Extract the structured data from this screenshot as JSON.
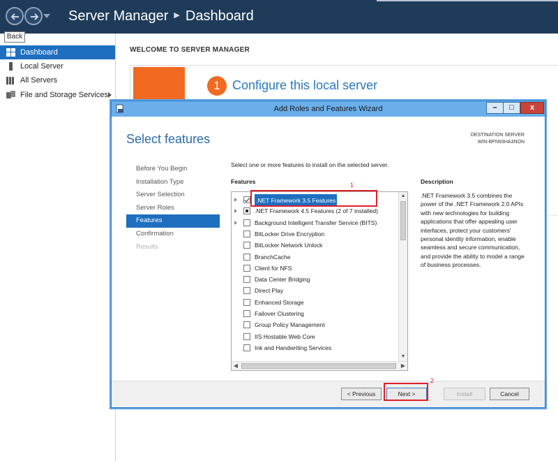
{
  "server_manager": {
    "title": "Server Manager",
    "breadcrumb_current": "Dashboard",
    "tooltip": "Back",
    "sidebar": {
      "items": [
        {
          "label": "Dashboard",
          "icon": "dashboard-icon",
          "active": true
        },
        {
          "label": "Local Server",
          "icon": "server-icon"
        },
        {
          "label": "All Servers",
          "icon": "servers-icon"
        },
        {
          "label": "File and Storage Services",
          "icon": "storage-icon",
          "has_submenu": true
        }
      ]
    },
    "main": {
      "welcome_heading": "WELCOME TO SERVER MANAGER",
      "step_number": "1",
      "step_text": "Configure this local server",
      "accent_color": "#f26a22"
    }
  },
  "wizard": {
    "title": "Add Roles and Features Wizard",
    "heading": "Select features",
    "destination_label": "DESTINATION SERVER",
    "destination_server": "WIN-BPN93HA3NON",
    "steps": [
      {
        "label": "Before You Begin",
        "state": "normal"
      },
      {
        "label": "Installation Type",
        "state": "normal"
      },
      {
        "label": "Server Selection",
        "state": "normal"
      },
      {
        "label": "Server Roles",
        "state": "normal"
      },
      {
        "label": "Features",
        "state": "active"
      },
      {
        "label": "Confirmation",
        "state": "normal"
      },
      {
        "label": "Results",
        "state": "disabled"
      }
    ],
    "instruction": "Select one or more features to install on the selected server.",
    "features_label": "Features",
    "features": [
      {
        "label": ".NET Framework 3.5 Features",
        "checked": "checked",
        "expandable": true,
        "selected": true
      },
      {
        "label": ".NET Framework 4.5 Features (2 of 7 installed)",
        "checked": "partial",
        "expandable": true
      },
      {
        "label": "Background Intelligent Transfer Service (BITS)",
        "checked": "none",
        "expandable": true
      },
      {
        "label": "BitLocker Drive Encryption",
        "checked": "none"
      },
      {
        "label": "BitLocker Network Unlock",
        "checked": "none"
      },
      {
        "label": "BranchCache",
        "checked": "none"
      },
      {
        "label": "Client for NFS",
        "checked": "none"
      },
      {
        "label": "Data Center Bridging",
        "checked": "none"
      },
      {
        "label": "Direct Play",
        "checked": "none"
      },
      {
        "label": "Enhanced Storage",
        "checked": "none"
      },
      {
        "label": "Failover Clustering",
        "checked": "none"
      },
      {
        "label": "Group Policy Management",
        "checked": "none"
      },
      {
        "label": "IIS Hostable Web Core",
        "checked": "none"
      },
      {
        "label": "Ink and Handwriting Services",
        "checked": "none"
      }
    ],
    "description_label": "Description",
    "description": ".NET Framework 3.5 combines the power of the .NET Framework 2.0 APIs with new technologies for building applications that offer appealing user interfaces, protect your customers' personal identity information, enable seamless and secure communication, and provide the ability to model a range of business processes.",
    "buttons": {
      "previous": "< Previous",
      "next": "Next >",
      "install": "Install",
      "cancel": "Cancel"
    },
    "window_controls": {
      "minimize": "–",
      "maximize": "□",
      "close": "x"
    }
  },
  "annotations": {
    "color": "#e0202a",
    "items": [
      {
        "number": "1",
        "target": "net-framework-35"
      },
      {
        "number": "2",
        "target": "next-button"
      }
    ]
  }
}
